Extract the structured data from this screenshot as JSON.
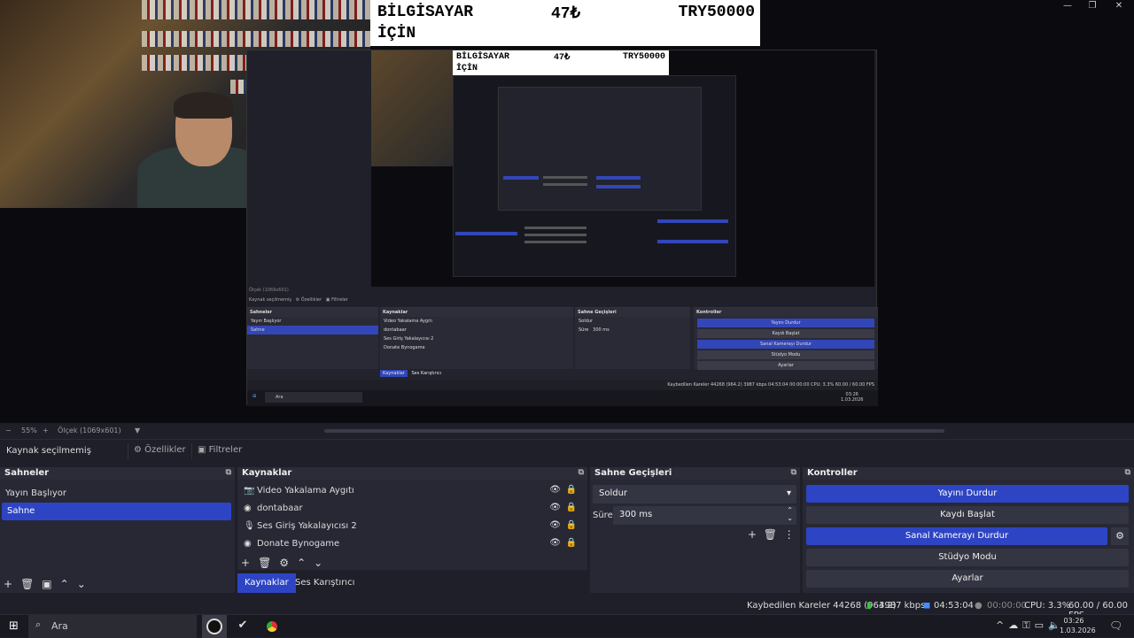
{
  "donation": {
    "line1": "BİLGİSAYAR",
    "line2": "İÇİN",
    "amount": "47₺",
    "price": "TRY50000"
  },
  "nested_donation": {
    "line1": "BİLGİSAYAR",
    "line2": "İÇİN",
    "amount": "47₺",
    "price": "TRY50000"
  },
  "window_controls": {
    "minimize": "—",
    "restore": "❐",
    "close": "✕"
  },
  "zoombar": {
    "minus": "−",
    "zoom": "55%",
    "plus": "+",
    "scale": "Ölçek (1069x601)",
    "arrow": "▼"
  },
  "source_toolbar": {
    "label": "Kaynak seçilmemiş",
    "properties": "Özellikler",
    "filters": "Filtreler"
  },
  "scenes": {
    "title": "Sahneler",
    "items": [
      "Yayın Başlıyor",
      "Sahne"
    ]
  },
  "sources": {
    "title": "Kaynaklar",
    "items": [
      "Video Yakalama Aygıtı",
      "dontabaar",
      "Ses Giriş Yakalayıcısı 2",
      "Donate Bynogame"
    ]
  },
  "transitions": {
    "title": "Sahne Geçişleri",
    "type": "Soldur",
    "duration_label": "Süre",
    "duration": "300 ms"
  },
  "controls": {
    "title": "Kontroller",
    "stop_stream": "Yayını Durdur",
    "start_record": "Kaydı Başlat",
    "stop_virtualcam": "Sanal Kamerayı Durdur",
    "studio_mode": "Stüdyo Modu",
    "settings": "Ayarlar"
  },
  "tabs": {
    "sources": "Kaynaklar",
    "mixer": "Ses Karıştırıcı"
  },
  "status": {
    "dropped": "Kaybedilen Kareler 44268 (964.2)",
    "bitrate": "3987 kbps",
    "stream_time": "04:53:04",
    "rec_time": "00:00:00",
    "cpu": "CPU: 3.3%",
    "fps": "60.00 / 60.00 FPS"
  },
  "taskbar": {
    "search": "Ara",
    "time": "03:26",
    "date": "1.03.2026"
  },
  "nested": {
    "scenes": "Sahneler",
    "sources": "Kaynaklar",
    "transitions": "Sahne Geçişleri",
    "controls": "Kontroller",
    "scene_items": [
      "Yayın Başlıyor",
      "Sahne"
    ],
    "source_items": [
      "Video Yakalama Aygıtı",
      "dontabaar",
      "Ses Giriş Yakalayıcısı 2",
      "Donate Bynogame"
    ],
    "fade": "Soldur",
    "dur_label": "Süre",
    "dur": "300 ms",
    "btns": [
      "Yayını Durdur",
      "Kaydı Başlat",
      "Sanal Kamerayı Durdur",
      "Stüdyo Modu",
      "Ayarlar"
    ],
    "status": "Kaybedilen Kareler 44268 (964.2)   3987 kbps   04:53:04   00:00:00   CPU: 3.3%   60.00 / 60.00 FPS",
    "no_source": "Kaynak seçilmemiş",
    "props": "Özellikler",
    "filters": "Filtreler",
    "search": "Ara",
    "tab_sources": "Kaynaklar",
    "tab_mixer": "Ses Karıştırıcı",
    "zoom": "Ölçek (1069x601)",
    "time": "03:26",
    "date": "1.03.2026"
  },
  "colors": {
    "accent": "#2d45c4",
    "panel": "#272834",
    "background": "#1e1f29"
  }
}
